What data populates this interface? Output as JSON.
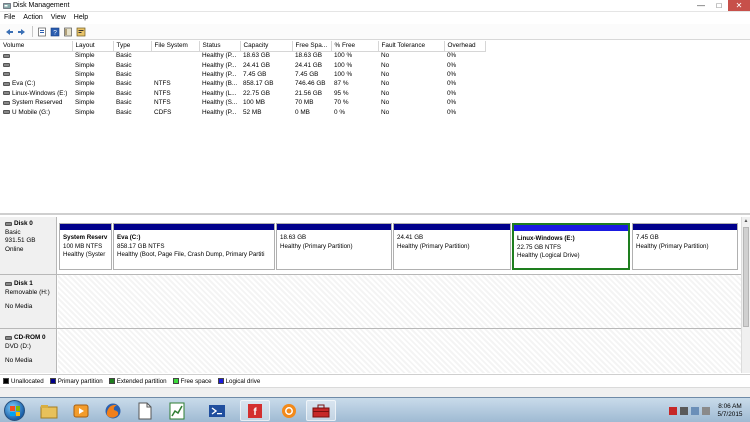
{
  "window": {
    "title": "Disk Management",
    "controls": [
      "—",
      "□",
      "✕"
    ]
  },
  "menu": [
    "File",
    "Action",
    "View",
    "Help"
  ],
  "toolbar_icons": [
    "back-icon",
    "forward-icon",
    "properties-icon",
    "help-icon",
    "help-book-icon",
    "properties-sheet-icon"
  ],
  "volume_table": {
    "columns": [
      "Volume",
      "Layout",
      "Type",
      "File System",
      "Status",
      "Capacity",
      "Free Spa...",
      "% Free",
      "Fault Tolerance",
      "Overhead"
    ],
    "rows": [
      [
        "",
        "Simple",
        "Basic",
        "",
        "Healthy (P...",
        "18.63 GB",
        "18.63 GB",
        "100 %",
        "No",
        "0%"
      ],
      [
        "",
        "Simple",
        "Basic",
        "",
        "Healthy (P...",
        "24.41 GB",
        "24.41 GB",
        "100 %",
        "No",
        "0%"
      ],
      [
        "",
        "Simple",
        "Basic",
        "",
        "Healthy (P...",
        "7.45 GB",
        "7.45 GB",
        "100 %",
        "No",
        "0%"
      ],
      [
        "Eva (C:)",
        "Simple",
        "Basic",
        "NTFS",
        "Healthy (B...",
        "858.17 GB",
        "746.46 GB",
        "87 %",
        "No",
        "0%"
      ],
      [
        "Linux-Windows (E:)",
        "Simple",
        "Basic",
        "NTFS",
        "Healthy (L...",
        "22.75 GB",
        "21.56 GB",
        "95 %",
        "No",
        "0%"
      ],
      [
        "System Reserved",
        "Simple",
        "Basic",
        "NTFS",
        "Healthy (S...",
        "100 MB",
        "70 MB",
        "70 %",
        "No",
        "0%"
      ],
      [
        "U Mobile (G:)",
        "Simple",
        "Basic",
        "CDFS",
        "Healthy (P...",
        "52 MB",
        "0 MB",
        "0 %",
        "No",
        "0%"
      ]
    ]
  },
  "disks": {
    "disk0": {
      "name": "Disk 0",
      "type": "Basic",
      "size": "931.51 GB",
      "state": "Online",
      "partitions": [
        {
          "name": "System Reserv",
          "size": "100 MB NTFS",
          "status": "Healthy (Syster"
        },
        {
          "name": "Eva  (C:)",
          "size": "858.17 GB NTFS",
          "status": "Healthy (Boot, Page File, Crash Dump, Primary Partiti"
        },
        {
          "name": "",
          "size": "18.63 GB",
          "status": "Healthy (Primary Partition)"
        },
        {
          "name": "",
          "size": "24.41 GB",
          "status": "Healthy (Primary Partition)"
        },
        {
          "name": "Linux-Windows  (E:)",
          "size": "22.75 GB NTFS",
          "status": "Healthy (Logical Drive)"
        },
        {
          "name": "",
          "size": "7.45 GB",
          "status": "Healthy (Primary Partition)"
        }
      ]
    },
    "disk1": {
      "name": "Disk 1",
      "type": "Removable (H:)",
      "state": "No Media"
    },
    "cdrom0": {
      "name": "CD-ROM 0",
      "type": "DVD (D:)",
      "state": "No Media"
    }
  },
  "legend": [
    {
      "label": "Unallocated",
      "color": "#000000"
    },
    {
      "label": "Primary partition",
      "color": "#00008b"
    },
    {
      "label": "Extended partition",
      "color": "#1e7e1e"
    },
    {
      "label": "Free space",
      "color": "#3cdc3c"
    },
    {
      "label": "Logical drive",
      "color": "#1a1ae0"
    }
  ],
  "taskbar": {
    "apps": [
      "file-explorer-icon",
      "media-player-icon",
      "firefox-icon",
      "document-icon",
      "spreadsheet-icon",
      "powershell-icon",
      "adobe-flash-icon",
      "ubuntu-icon",
      "toolbox-icon"
    ],
    "time": "8:06 AM",
    "date": "5/7/2015"
  }
}
